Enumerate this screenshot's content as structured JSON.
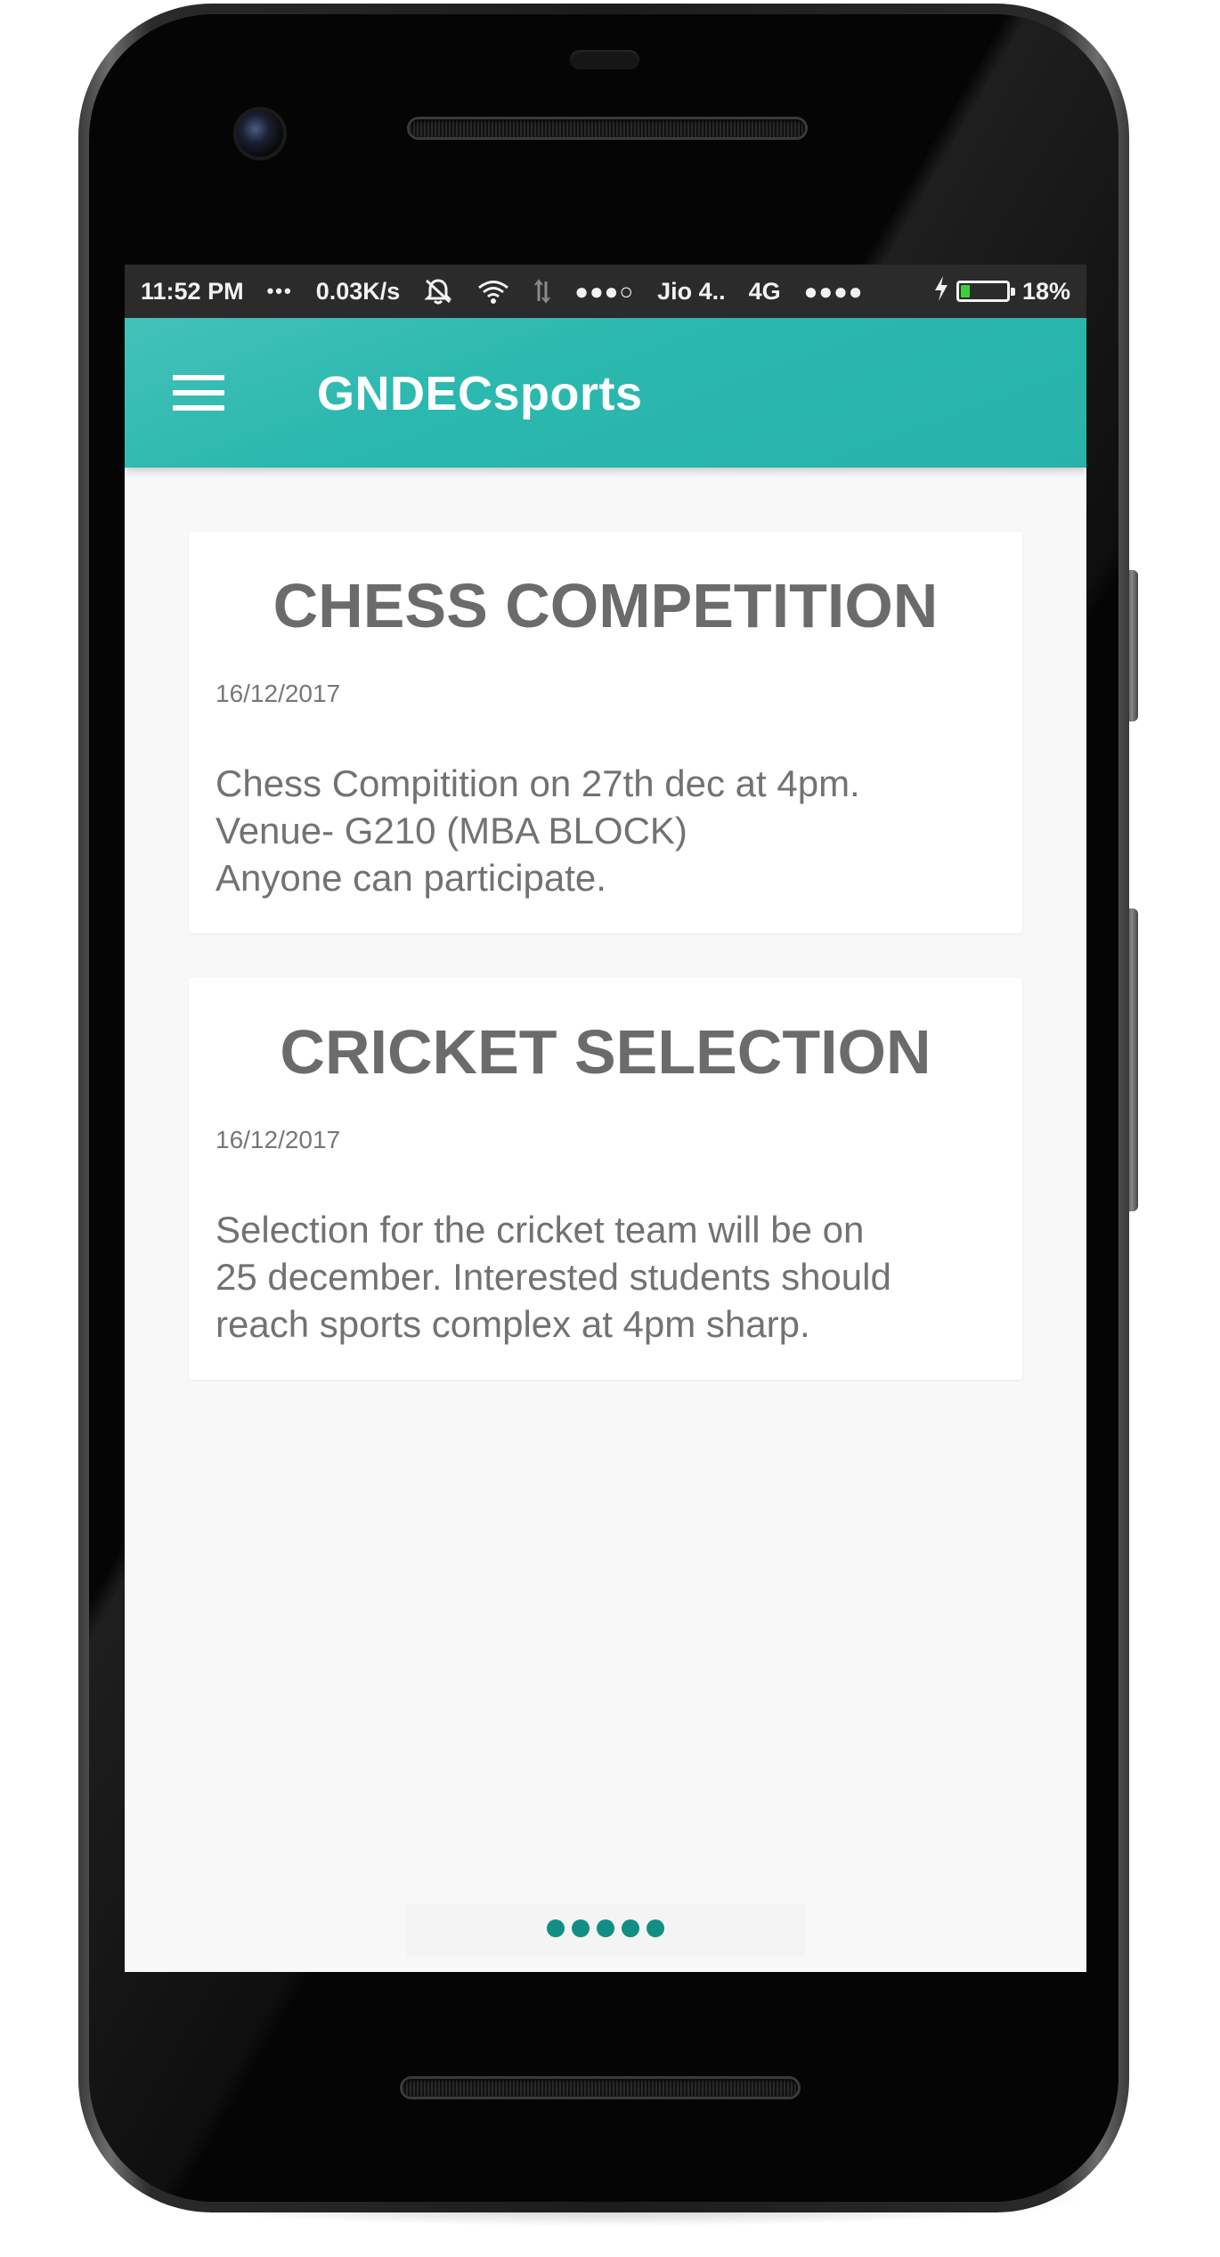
{
  "status_bar": {
    "time": "11:52 PM",
    "more_dots": "•••",
    "net_speed": "0.03K/s",
    "signal_sim1": "●●●○",
    "carrier": "Jio 4..",
    "network_type": "4G",
    "signal_sim2": "●●●●",
    "battery_percent": "18%",
    "battery_level": 0.18,
    "battery_color": "#39d13a"
  },
  "app_bar": {
    "title": "GNDECsports",
    "menu_icon": "hamburger-menu-icon",
    "color": "#2bb8ae"
  },
  "posts": [
    {
      "title": "CHESS COMPETITION",
      "date": "16/12/2017",
      "body": "Chess Compitition on 27th dec at 4pm.\nVenue- G210 (MBA BLOCK)\nAnyone can participate."
    },
    {
      "title": "CRICKET SELECTION",
      "date": "16/12/2017",
      "body": "Selection for the cricket team will be on\n25 december. Interested students should\nreach sports complex at 4pm sharp."
    }
  ],
  "pager": {
    "dot_count": 5,
    "dot_color": "#128f85"
  }
}
